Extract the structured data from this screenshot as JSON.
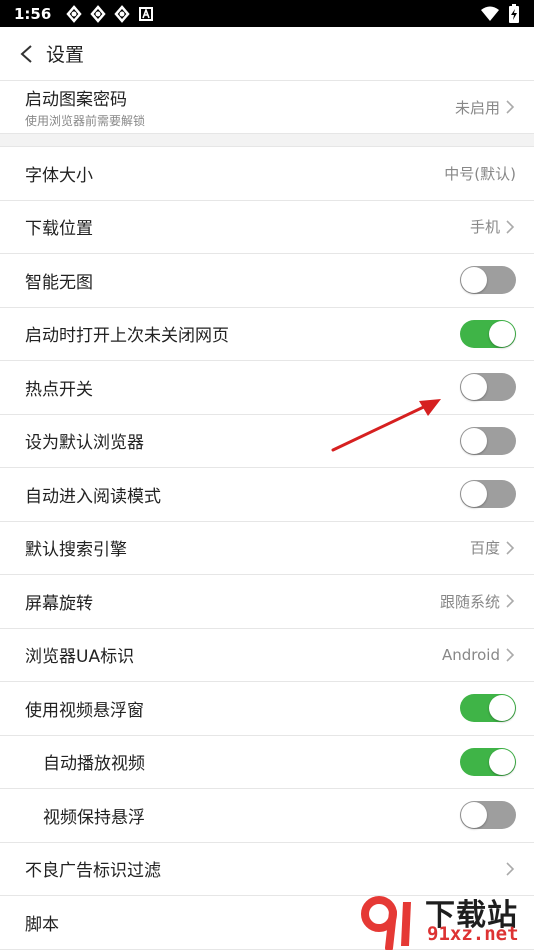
{
  "status": {
    "time": "1:56",
    "icons": [
      "sync-icon",
      "sync-icon",
      "sync-icon",
      "a-badge-icon"
    ],
    "right_icons": [
      "wifi-icon",
      "battery-charging-icon"
    ]
  },
  "header": {
    "title": "设置",
    "back_icon": "chevron-left-icon"
  },
  "settings": [
    {
      "label": "启动图案密码",
      "sub": "使用浏览器前需要解锁",
      "value": "未启用",
      "chevron": true
    },
    {
      "label": "字体大小",
      "value": "中号(默认)",
      "chevron": false
    },
    {
      "label": "下载位置",
      "value": "手机",
      "chevron": true
    },
    {
      "label": "智能无图",
      "toggle": false
    },
    {
      "label": "启动时打开上次未关闭网页",
      "toggle": true
    },
    {
      "label": "热点开关",
      "toggle": false
    },
    {
      "label": "设为默认浏览器",
      "toggle": false
    },
    {
      "label": "自动进入阅读模式",
      "toggle": false
    },
    {
      "label": "默认搜索引擎",
      "value": "百度",
      "chevron": true
    },
    {
      "label": "屏幕旋转",
      "value": "跟随系统",
      "chevron": true
    },
    {
      "label": "浏览器UA标识",
      "value": "Android",
      "chevron": true
    },
    {
      "label": "使用视频悬浮窗",
      "toggle": true
    },
    {
      "label": "自动播放视频",
      "toggle": true
    },
    {
      "label": "视频保持悬浮",
      "toggle": false
    },
    {
      "label": "不良广告标识过滤",
      "chevron": true
    },
    {
      "label": "脚本"
    }
  ],
  "watermark": {
    "title": "下载站",
    "url": "91xz.net"
  },
  "colors": {
    "toggle_on": "#3fb447",
    "toggle_off": "#9e9e9e",
    "annotation_arrow": "#d62020"
  }
}
